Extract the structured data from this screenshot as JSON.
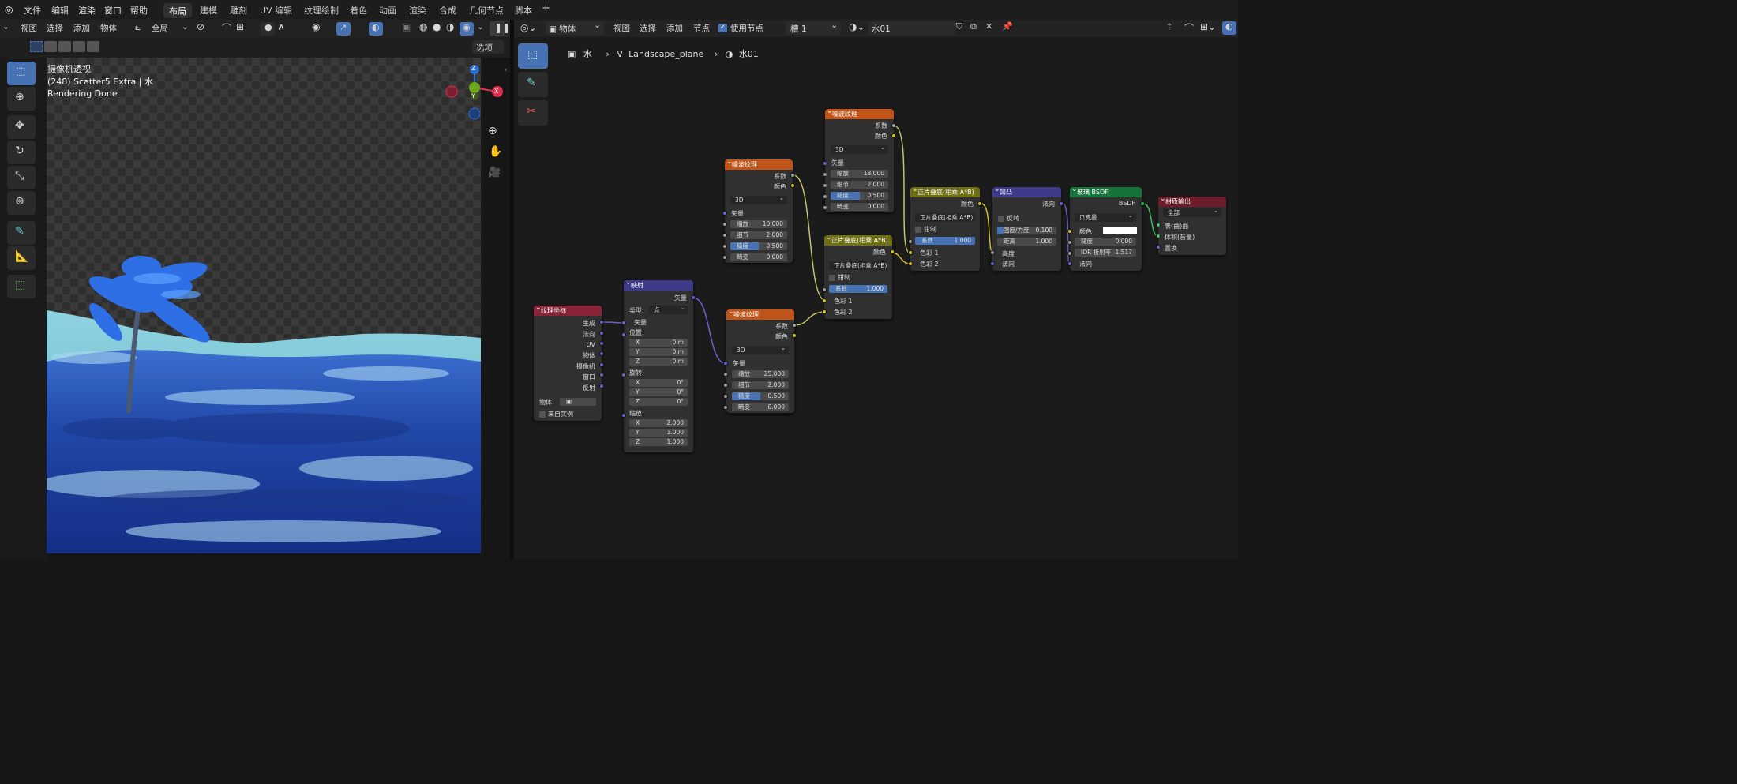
{
  "menubar": {
    "items": [
      "文件",
      "编辑",
      "渲染",
      "窗口",
      "帮助"
    ]
  },
  "workspaces": {
    "tabs": [
      "布局",
      "建模",
      "雕刻",
      "UV 编辑",
      "纹理绘制",
      "着色",
      "动画",
      "渲染",
      "合成",
      "几何节点",
      "脚本"
    ],
    "add": "+"
  },
  "viewport": {
    "header": {
      "view": "视图",
      "select": "选择",
      "add": "添加",
      "object": "物体",
      "orientation": "全局"
    },
    "options": "选项",
    "overlay": {
      "line1": "摄像机透视",
      "line2": "(248) Scatter5 Extra | 水",
      "line3": "Rendering Done"
    },
    "gizmo": {
      "z": "Z",
      "y": "Y",
      "x": "X"
    }
  },
  "node_editor": {
    "header": {
      "type": "物体",
      "view": "视图",
      "select": "选择",
      "add": "添加",
      "node": "节点",
      "use_nodes": "使用节点",
      "slot": "槽 1",
      "material": "水01"
    },
    "breadcrumb": {
      "object": "水",
      "mesh": "Landscape_plane",
      "material": "水01"
    },
    "nodes": {
      "texcoord": {
        "title": "纹理坐标",
        "outputs": [
          "生成",
          "法向",
          "UV",
          "物体",
          "摄像机",
          "窗口",
          "反射"
        ],
        "object_label": "物体:",
        "from_instancer": "来自实例"
      },
      "mapping": {
        "title": "映射",
        "out": "矢量",
        "type_label": "类型:",
        "type": "点",
        "vector": "矢量",
        "location": "位置:",
        "rotation": "旋转:",
        "scale": "缩放:",
        "loc": [
          [
            "X",
            "0 m"
          ],
          [
            "Y",
            "0 m"
          ],
          [
            "Z",
            "0 m"
          ]
        ],
        "rot": [
          [
            "X",
            "0°"
          ],
          [
            "Y",
            "0°"
          ],
          [
            "Z",
            "0°"
          ]
        ],
        "scl": [
          [
            "X",
            "2.000"
          ],
          [
            "Y",
            "1.000"
          ],
          [
            "Z",
            "1.000"
          ]
        ]
      },
      "noise1": {
        "title": "噪波纹理",
        "fac": "系数",
        "color": "颜色",
        "dim": "3D",
        "vector": "矢量",
        "fields": [
          [
            "缩放",
            "10.000"
          ],
          [
            "细节",
            "2.000"
          ],
          [
            "糙度",
            "0.500"
          ],
          [
            "畸变",
            "0.000"
          ]
        ],
        "roughness_fill": 0.5
      },
      "noise2": {
        "title": "噪波纹理",
        "fac": "系数",
        "color": "颜色",
        "dim": "3D",
        "vector": "矢量",
        "fields": [
          [
            "缩放",
            "18.000"
          ],
          [
            "细节",
            "2.000"
          ],
          [
            "糙度",
            "0.500"
          ],
          [
            "畸变",
            "0.000"
          ]
        ],
        "roughness_fill": 0.5
      },
      "noise3": {
        "title": "噪波纹理",
        "fac": "系数",
        "color": "颜色",
        "dim": "3D",
        "vector": "矢量",
        "fields": [
          [
            "缩放",
            "25.000"
          ],
          [
            "细节",
            "2.000"
          ],
          [
            "糙度",
            "0.500"
          ],
          [
            "畸变",
            "0.000"
          ]
        ],
        "roughness_fill": 0.5
      },
      "mix1": {
        "title": "正片叠底(相乘 A*B)",
        "color": "颜色",
        "mode": "正片叠底(相乘 A*B)",
        "clamp": "钳制",
        "fac": "系数",
        "fac_value": "1.000",
        "c1": "色彩 1",
        "c2": "色彩 2"
      },
      "mix2": {
        "title": "正片叠底(相乘 A*B)",
        "color": "颜色",
        "mode": "正片叠底(相乘 A*B)",
        "clamp": "钳制",
        "fac": "系数",
        "fac_value": "1.000",
        "c1": "色彩 1",
        "c2": "色彩 2"
      },
      "bump": {
        "title": "凹凸",
        "normal_out": "法向",
        "invert": "反转",
        "strength": "强度/力度",
        "strength_value": "0.100",
        "distance": "距离",
        "distance_value": "1.000",
        "height": "高度",
        "normal": "法向",
        "strength_fill": 0.1
      },
      "glass": {
        "title": "玻璃 BSDF",
        "out": "BSDF",
        "dist": "贝克曼",
        "color": "颜色",
        "roughness": "糙度",
        "roughness_value": "0.000",
        "ior": "IOR 折射率",
        "ior_value": "1.517",
        "normal": "法向"
      },
      "output": {
        "title": "材质输出",
        "target": "全部",
        "surface": "表(曲)面",
        "volume": "体积(音量)",
        "displacement": "置换"
      }
    }
  }
}
